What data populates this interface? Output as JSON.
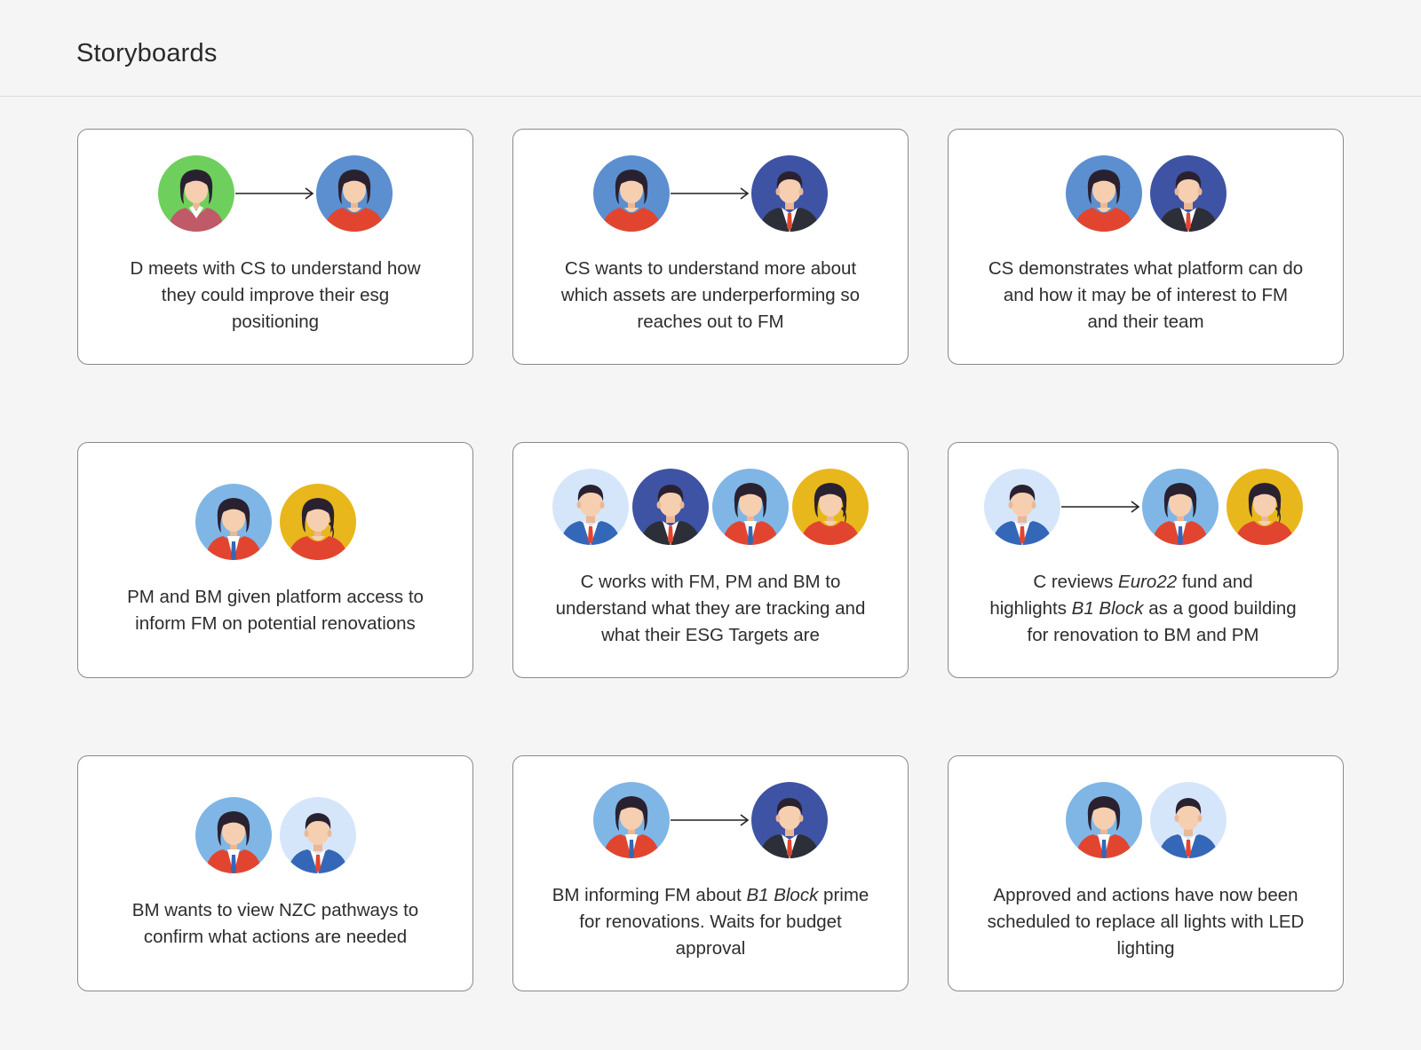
{
  "page": {
    "title": "Storyboards"
  },
  "colors": {
    "background": "#f5f5f5",
    "card_border": "#8a8a8a",
    "green": "#6fcf5c",
    "blue": "#5b8fd0",
    "navy": "#3e53a3",
    "sky": "#7fb6e6",
    "pale": "#d6e6fa",
    "yellow": "#e8b71c",
    "red": "#e2452f"
  },
  "cards": [
    {
      "avatars": [
        "green-woman-icon",
        "arrow-icon",
        "blue-woman-icon"
      ],
      "caption": [
        "D meets with CS to understand how",
        "they could improve their esg",
        "positioning"
      ]
    },
    {
      "avatars": [
        "blue-woman-icon",
        "arrow-icon",
        "navy-man-icon"
      ],
      "caption": [
        "CS wants to understand more about",
        "which assets are underperforming so",
        "reaches out to FM"
      ]
    },
    {
      "avatars": [
        "blue-woman-icon",
        "navy-man-icon"
      ],
      "caption": [
        "CS demonstrates what platform can do",
        "and how it may be of interest to FM",
        "and their team"
      ]
    },
    {
      "avatars": [
        "sky-woman-icon",
        "yellow-woman-icon"
      ],
      "caption": [
        "PM and BM given platform access to",
        "inform FM on potential renovations"
      ]
    },
    {
      "avatars": [
        "pale-man-icon",
        "navy-man-icon",
        "sky-woman-icon",
        "yellow-woman-icon"
      ],
      "caption": [
        "C works with FM, PM and BM to",
        "understand what they are tracking and",
        "what their ESG Targets are"
      ]
    },
    {
      "avatars": [
        "pale-man-icon",
        "arrow-icon",
        "sky-woman-icon",
        "yellow-woman-icon"
      ],
      "caption_parts": [
        [
          "C reviews ",
          "Euro22",
          " fund and"
        ],
        [
          "highlights ",
          "B1 Block",
          " as a good building"
        ],
        [
          "for renovation to BM and PM"
        ]
      ]
    },
    {
      "avatars": [
        "sky-woman-icon",
        "pale-man-icon"
      ],
      "caption": [
        "BM wants to view NZC pathways to",
        "confirm what actions are needed"
      ]
    },
    {
      "avatars": [
        "sky-woman-icon",
        "arrow-icon",
        "navy-man-icon"
      ],
      "caption_parts": [
        [
          "BM informing FM about ",
          "B1 Block",
          " prime"
        ],
        [
          "for renovations. Waits for budget"
        ],
        [
          "approval"
        ]
      ]
    },
    {
      "avatars": [
        "sky-woman-icon",
        "pale-man-icon"
      ],
      "caption": [
        "Approved and actions have now been",
        "scheduled to replace all lights with LED",
        "lighting"
      ]
    }
  ]
}
